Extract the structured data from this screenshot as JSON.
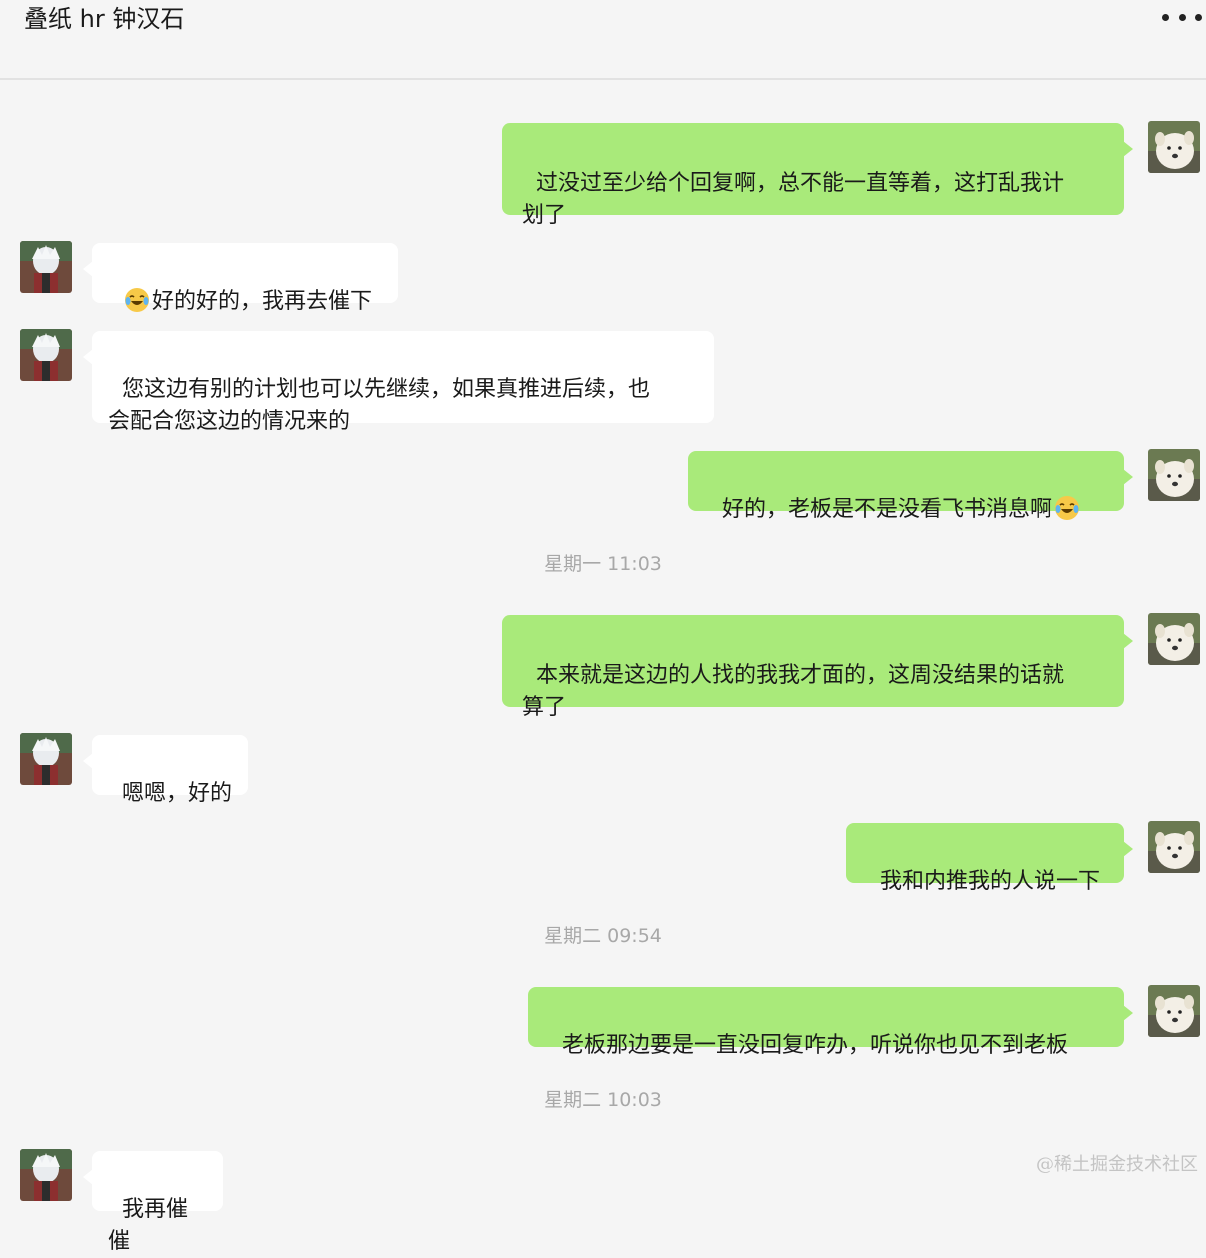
{
  "header": {
    "title": "叠纸 hr 钟汉石",
    "more_icon": "more-icon"
  },
  "messages": [
    {
      "side": "me",
      "text": "过没过至少给个回复啊，总不能一直等着，这打乱我计\n划了"
    },
    {
      "side": "other",
      "emoji_prefix": "laugh-cry-emoji",
      "text": "好的好的，我再去催下"
    },
    {
      "side": "other",
      "text": "您这边有别的计划也可以先继续，如果真推进后续，也\n会配合您这边的情况来的"
    },
    {
      "side": "me",
      "text": "好的，老板是不是没看飞书消息啊",
      "emoji_suffix": "laugh-cry-emoji"
    },
    {
      "side": "me",
      "text": "本来就是这边的人找的我我才面的，这周没结果的话就\n算了"
    },
    {
      "side": "other",
      "text": "嗯嗯，好的"
    },
    {
      "side": "me",
      "text": "我和内推我的人说一下"
    },
    {
      "side": "me",
      "text": "老板那边要是一直没回复咋办，听说你也见不到老板"
    },
    {
      "side": "other",
      "text": "我再催催"
    }
  ],
  "timestamps": [
    "星期一 11:03",
    "星期二 09:54",
    "星期二 10:03"
  ],
  "watermark": "@稀土掘金技术社区",
  "colors": {
    "background": "#f5f5f5",
    "my_bubble": "#a9ea7a",
    "other_bubble": "#ffffff",
    "timestamp": "#a8a8a8"
  }
}
